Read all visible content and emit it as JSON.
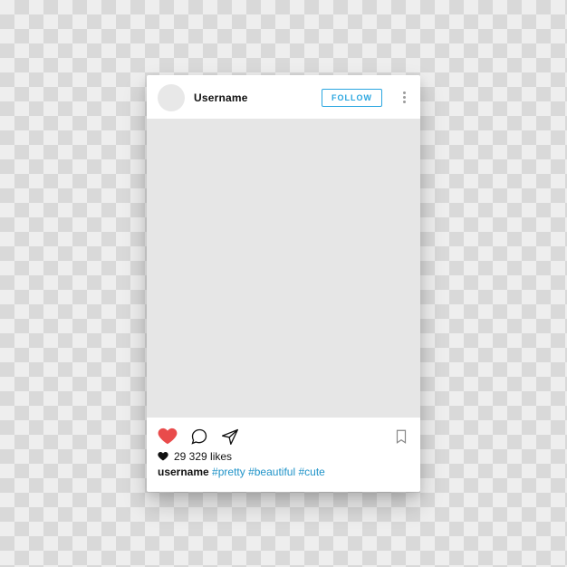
{
  "header": {
    "username": "Username",
    "follow_label": "FOLLOW"
  },
  "engagement": {
    "likes_text": "29 329 likes"
  },
  "caption": {
    "username": "username",
    "hashtags": [
      "#pretty",
      "#beautiful",
      "#cute"
    ]
  },
  "colors": {
    "heart_fill": "#e94b4b",
    "accent_link": "#1f93c8",
    "follow_border": "#2aa6e0"
  }
}
